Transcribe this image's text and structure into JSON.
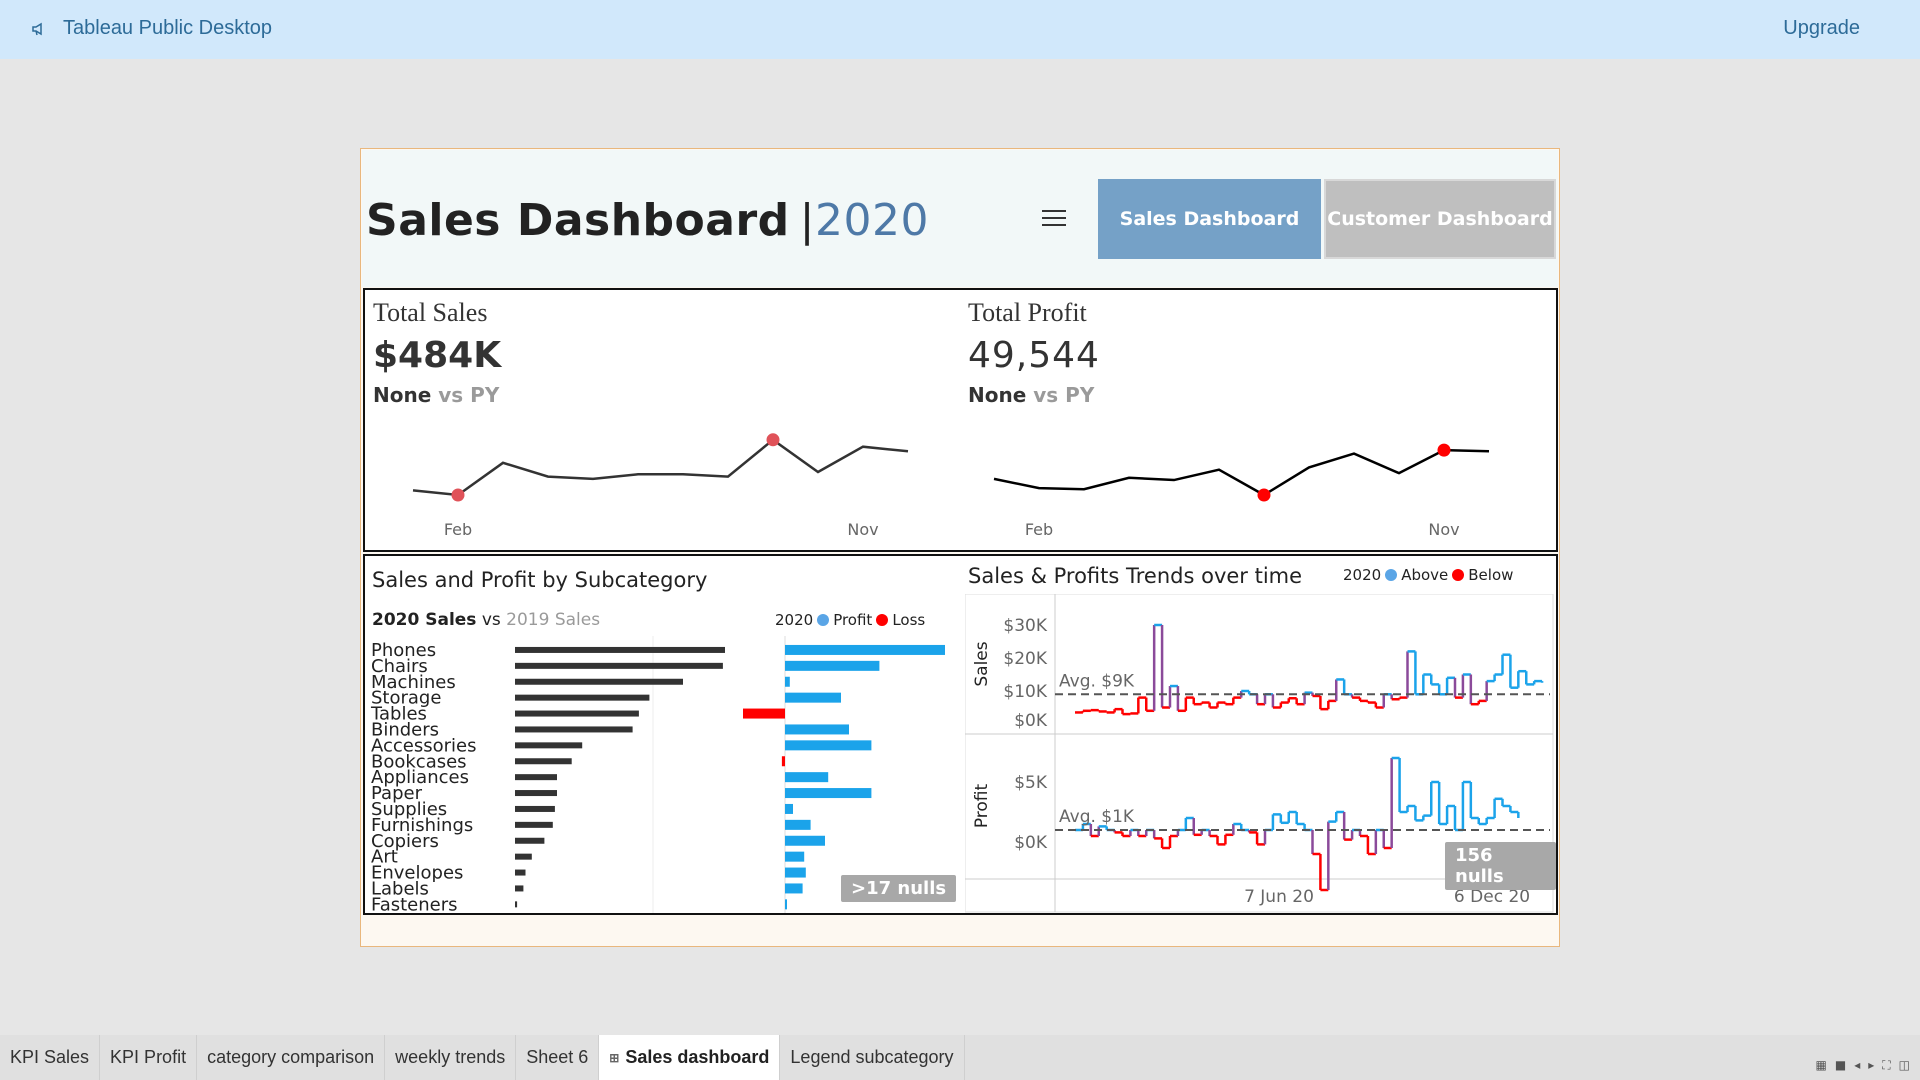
{
  "app": {
    "title": "Tableau Public Desktop",
    "upgrade_label": "Upgrade"
  },
  "header": {
    "title": "Sales Dashboard",
    "separator": "|",
    "year": "2020",
    "nav_buttons": [
      {
        "label": "Sales Dashboard",
        "active": true
      },
      {
        "label": "Customer Dashboard",
        "active": false
      }
    ]
  },
  "kpis": [
    {
      "label": "Total Sales",
      "value": "$484K",
      "comparison": "None",
      "comparison_suffix": "vs PY",
      "x_tick_first": "Feb",
      "x_tick_last": "Nov",
      "trend": [
        18,
        14,
        42,
        30,
        28,
        32,
        32,
        30,
        62,
        34,
        56,
        52
      ],
      "min_index": 1,
      "max_index": 8,
      "marker_color": "#e05259",
      "line_color": "#333333"
    },
    {
      "label": "Total Profit",
      "value": "49,544",
      "comparison": "None",
      "comparison_suffix": "vs PY",
      "x_tick_first": "Feb",
      "x_tick_last": "Nov",
      "trend": [
        28,
        20,
        19,
        29,
        27,
        36,
        14,
        38,
        50,
        33,
        53,
        52
      ],
      "min_index": 6,
      "max_index": 10,
      "marker_color": "#ff0000",
      "line_color": "#000000"
    }
  ],
  "subcategory": {
    "title": "Sales and Profit by Subcategory",
    "sales_bold": "2020 Sales",
    "sales_vs": "vs",
    "sales_compare": "2019 Sales",
    "legend": {
      "year": "2020",
      "profit": "Profit",
      "loss": "Loss"
    },
    "nulls": ">17 nulls",
    "chart_data": {
      "type": "bar",
      "categories": [
        "Phones",
        "Chairs",
        "Machines",
        "Storage",
        "Tables",
        "Binders",
        "Accessories",
        "Bookcases",
        "Appliances",
        "Paper",
        "Supplies",
        "Furnishings",
        "Copiers",
        "Art",
        "Envelopes",
        "Labels",
        "Fasteners"
      ],
      "series": [
        {
          "name": "2020 Sales",
          "values": [
            100,
            99,
            80,
            64,
            59,
            56,
            32,
            27,
            20,
            20,
            19,
            18,
            14,
            8,
            5,
            4,
            1
          ]
        },
        {
          "name": "Profit",
          "values": [
            100,
            59,
            3,
            35,
            -27,
            40,
            54,
            -2,
            27,
            54,
            5,
            16,
            25,
            12,
            13,
            11,
            1
          ]
        }
      ],
      "colors": {
        "sales": "#333333",
        "profit": "#1ba3ea",
        "loss": "#ff0000"
      }
    }
  },
  "trends": {
    "title": "Sales & Profits Trends over time",
    "legend": {
      "year": "2020",
      "above": "Above",
      "below": "Below"
    },
    "sales_axis_label": "Sales",
    "profit_axis_label": "Profit",
    "sales_ticks": [
      "$30K",
      "$20K",
      "$10K",
      "$0K"
    ],
    "profit_ticks": [
      "$5K",
      "$0K"
    ],
    "sales_avg_label": "Avg. $9K",
    "profit_avg_label": "Avg. $1K",
    "x_ticks": [
      "7 Jun 20",
      "6 Dec 20"
    ],
    "nulls": "156 nulls",
    "chart_data": {
      "type": "line",
      "sales_weekly": [
        3.5,
        4,
        4.2,
        3.8,
        3.5,
        4.5,
        3,
        3.2,
        8,
        4,
        30,
        5,
        11.5,
        4,
        8,
        6,
        6.5,
        5,
        6.5,
        6,
        8,
        10,
        9,
        6,
        9,
        5,
        6.5,
        7.8,
        6,
        9.5,
        8.5,
        4.5,
        7,
        13.5,
        9,
        8,
        7,
        6.5,
        5,
        9,
        7.5,
        8,
        22,
        9,
        15,
        12,
        9,
        14,
        8,
        15,
        6,
        7,
        13,
        15,
        21,
        11,
        16,
        12,
        13,
        12.5
      ],
      "profit_weekly": [
        1,
        1.5,
        0.5,
        1.3,
        1,
        0.8,
        0.5,
        1,
        0.5,
        1,
        0.3,
        -0.5,
        0.5,
        1,
        2,
        0.6,
        1,
        0.5,
        -0.2,
        0.6,
        1.5,
        1,
        0.8,
        -0.2,
        1,
        2.3,
        1.6,
        2.5,
        1.5,
        1,
        -1,
        -4,
        1.7,
        2.5,
        0.2,
        1,
        0.5,
        -1,
        1,
        -0.5,
        7,
        2.5,
        3,
        1.8,
        2.2,
        5,
        1.5,
        3,
        1,
        5,
        2,
        1.5,
        2,
        3.6,
        3,
        2.5,
        2
      ],
      "sales_avg": 9,
      "profit_avg": 1,
      "colors": {
        "above": "#1ba3ea",
        "below": "#ff0000"
      }
    }
  },
  "tabs": [
    {
      "label": "KPI Sales",
      "active": false
    },
    {
      "label": "KPI Profit",
      "active": false
    },
    {
      "label": "category comparison",
      "active": false
    },
    {
      "label": "weekly trends",
      "active": false
    },
    {
      "label": "Sheet 6",
      "active": false
    },
    {
      "label": "Sales dashboard",
      "active": true
    },
    {
      "label": "Legend subcategory",
      "active": false
    }
  ]
}
